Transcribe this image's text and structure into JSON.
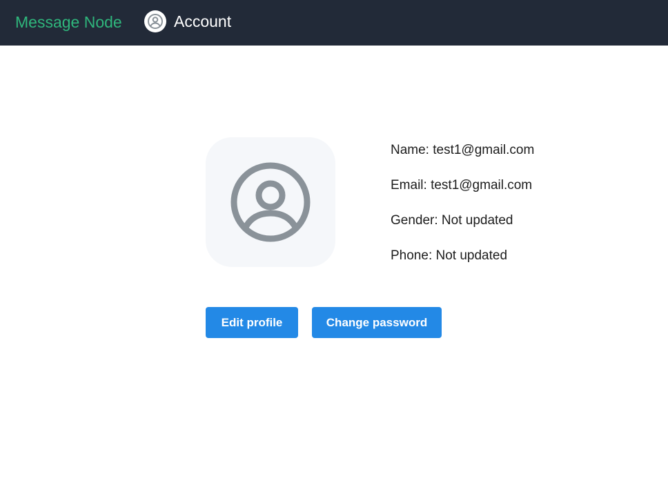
{
  "nav": {
    "brand": "Message Node",
    "account_label": "Account",
    "account_icon": "user-circle-icon"
  },
  "colors": {
    "nav_background": "#222a38",
    "brand_text": "#2fb67c",
    "button_primary": "#2389e6",
    "avatar_card_background": "#f5f7fa",
    "avatar_icon": "#8a9299"
  },
  "profile": {
    "avatar_icon": "user-circle-icon",
    "fields": [
      {
        "label": "Name",
        "value": "test1@gmail.com"
      },
      {
        "label": "Email",
        "value": "test1@gmail.com"
      },
      {
        "label": "Gender",
        "value": "Not updated"
      },
      {
        "label": "Phone",
        "value": "Not updated"
      }
    ],
    "lines": [
      "Name: test1@gmail.com",
      "Email: test1@gmail.com",
      "Gender: Not updated",
      "Phone: Not updated"
    ]
  },
  "actions": {
    "edit_profile": "Edit profile",
    "change_password": "Change password"
  }
}
